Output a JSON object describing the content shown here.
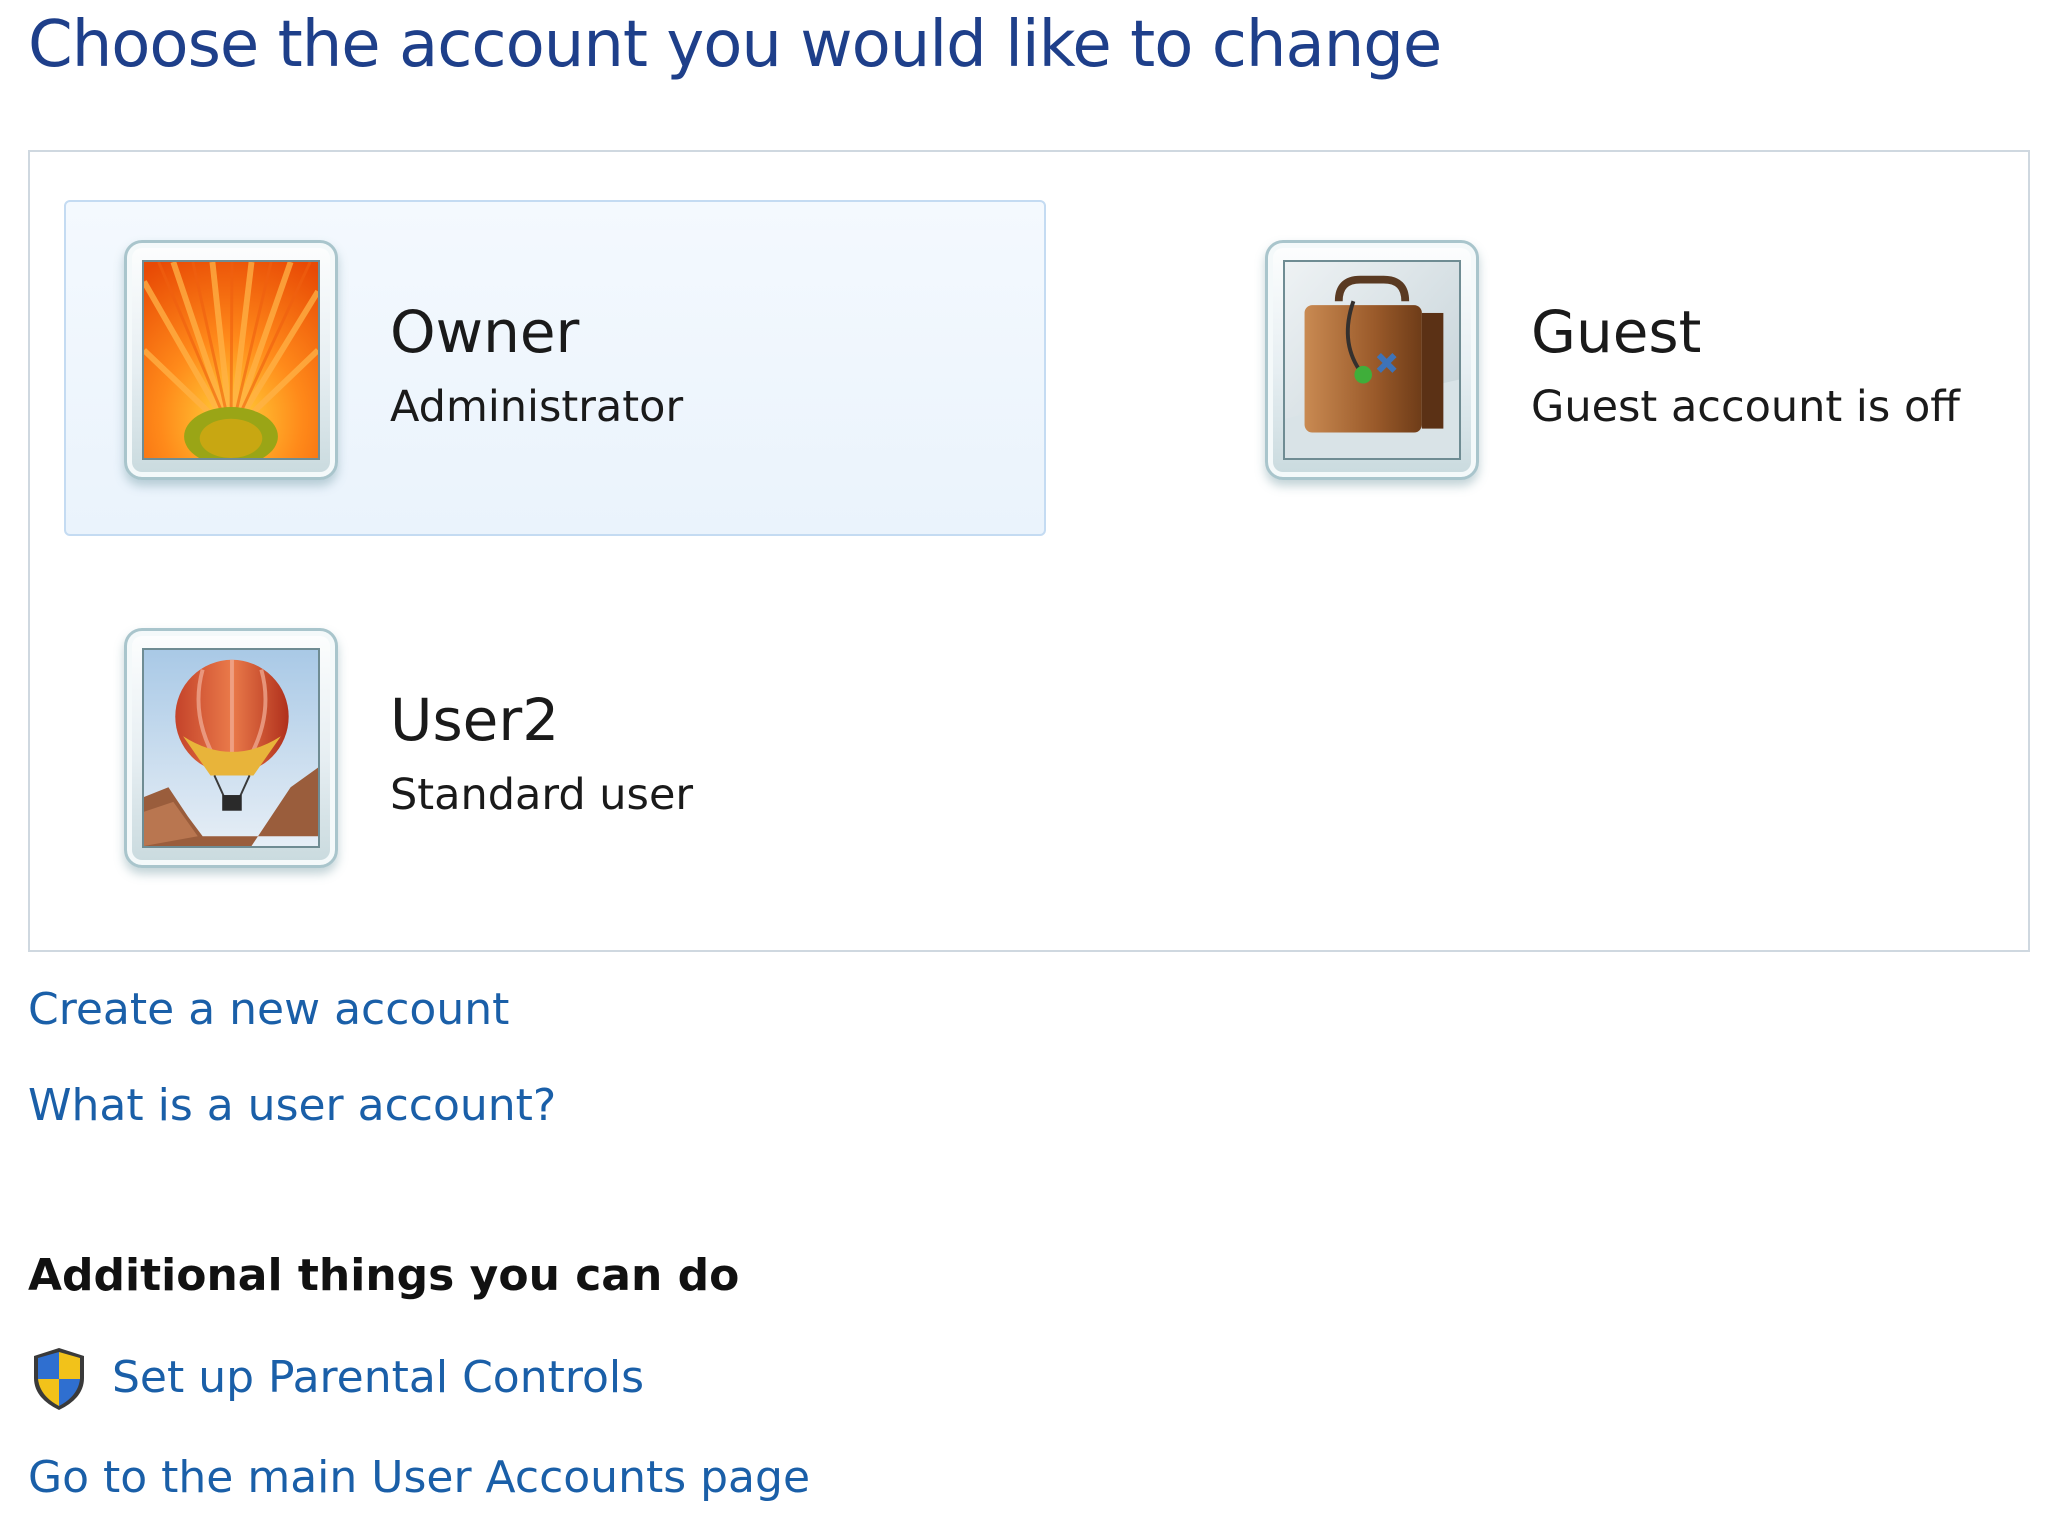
{
  "page": {
    "title": "Choose the account you would like to change"
  },
  "accounts": [
    {
      "name": "Owner",
      "type": "Administrator",
      "picture_icon": "flower-icon",
      "selected": true
    },
    {
      "name": "Guest",
      "type": "Guest account is off",
      "picture_icon": "briefcase-icon",
      "selected": false
    },
    {
      "name": "User2",
      "type": "Standard user",
      "picture_icon": "hot-air-balloon-icon",
      "selected": false
    }
  ],
  "links": {
    "create_account": "Create a new account",
    "what_is_account": "What is a user account?"
  },
  "additional": {
    "heading": "Additional things you can do",
    "parental_controls": "Set up Parental Controls",
    "parental_controls_icon": "uac-shield-icon",
    "main_page": "Go to the main User Accounts page"
  },
  "colors": {
    "title": "#1e3f8a",
    "link": "#1a5fa8",
    "selected_tile_bg": "#eaf3fc",
    "selected_tile_border": "#c4dbf2"
  }
}
